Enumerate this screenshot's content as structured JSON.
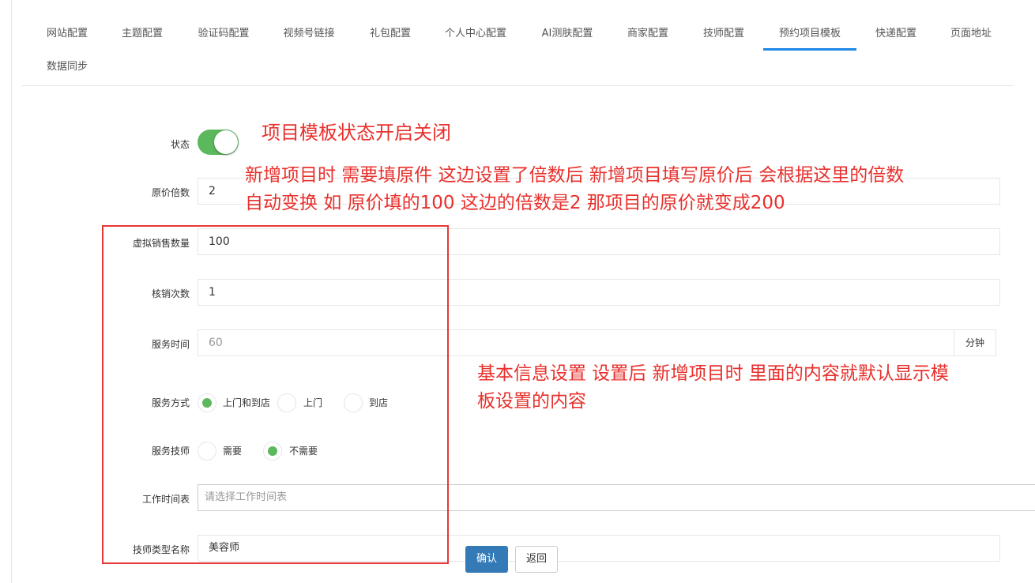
{
  "tabs": [
    {
      "label": "网站配置"
    },
    {
      "label": "主题配置"
    },
    {
      "label": "验证码配置"
    },
    {
      "label": "视频号链接"
    },
    {
      "label": "礼包配置"
    },
    {
      "label": "个人中心配置"
    },
    {
      "label": "AI测肤配置"
    },
    {
      "label": "商家配置"
    },
    {
      "label": "技师配置"
    },
    {
      "label": "预约项目模板",
      "active": true
    },
    {
      "label": "快递配置"
    },
    {
      "label": "页面地址"
    },
    {
      "label": "数据同步"
    }
  ],
  "form": {
    "status_label": "状态",
    "status_on": true,
    "price_multiplier_label": "原价倍数",
    "price_multiplier_value": "2",
    "virtual_sales_label": "虚拟销售数量",
    "virtual_sales_value": "100",
    "verify_count_label": "核销次数",
    "verify_count_value": "1",
    "service_time_label": "服务时间",
    "service_time_value": "60",
    "service_time_unit": "分钟",
    "service_mode_label": "服务方式",
    "service_mode_options": [
      {
        "label": "上门和到店",
        "checked": true
      },
      {
        "label": "上门",
        "checked": false
      },
      {
        "label": "到店",
        "checked": false
      }
    ],
    "technician_label": "服务技师",
    "technician_options": [
      {
        "label": "需要",
        "checked": false
      },
      {
        "label": "不需要",
        "checked": true
      }
    ],
    "schedule_label": "工作时间表",
    "schedule_placeholder": "请选择工作时间表",
    "tech_type_label": "技师类型名称",
    "tech_type_value": "美容师"
  },
  "buttons": {
    "confirm": "确认",
    "back": "返回"
  },
  "annotations": {
    "status_note": "项目模板状态开启关闭",
    "multiplier_note_line1": "新增项目时 需要填原件 这边设置了倍数后 新增项目填写原价后 会根据这里的倍数",
    "multiplier_note_line2": "自动变换  如 原价填的100  这边的倍数是2  那项目的原价就变成200",
    "basic_note_line1": "基本信息设置 设置后 新增项目时 里面的内容就默认显示模",
    "basic_note_line2": "板设置的内容"
  },
  "colors": {
    "accent": "#1e88e5",
    "toggle_on": "#5cb85c",
    "annotation": "#e8302c",
    "primary_button": "#337ab7"
  }
}
